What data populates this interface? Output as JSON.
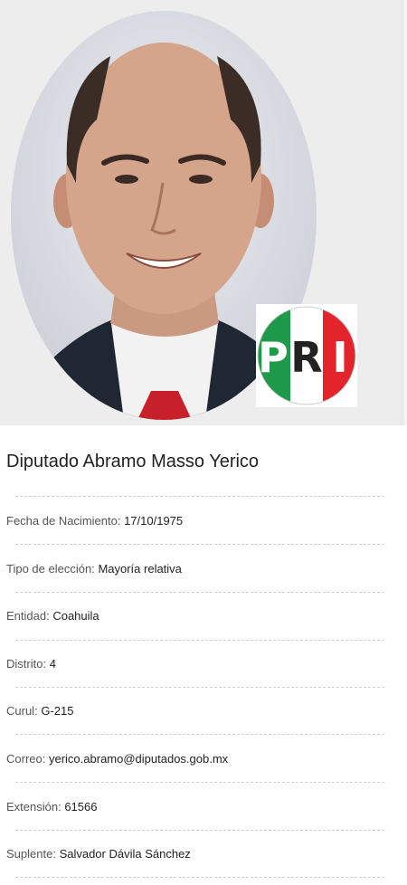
{
  "profile": {
    "title": "Diputado Abramo Masso Yerico",
    "party_logo": {
      "letters": [
        "P",
        "R",
        "I"
      ],
      "colors": {
        "green": "#1f9a4a",
        "white": "#ffffff",
        "red": "#e4242b"
      }
    }
  },
  "fields": [
    {
      "label": "Fecha de Nacimiento:",
      "value": "17/10/1975"
    },
    {
      "label": "Tipo de elección:",
      "value": "Mayoría relativa"
    },
    {
      "label": "Entidad:",
      "value": "Coahuila"
    },
    {
      "label": "Distrito:",
      "value": "4"
    },
    {
      "label": "Curul:",
      "value": "G-215"
    },
    {
      "label": "Correo:",
      "value": "yerico.abramo@diputados.gob.mx"
    },
    {
      "label": "Extensión:",
      "value": "61566"
    },
    {
      "label": "Suplente:",
      "value": "Salvador Dávila Sánchez"
    }
  ]
}
